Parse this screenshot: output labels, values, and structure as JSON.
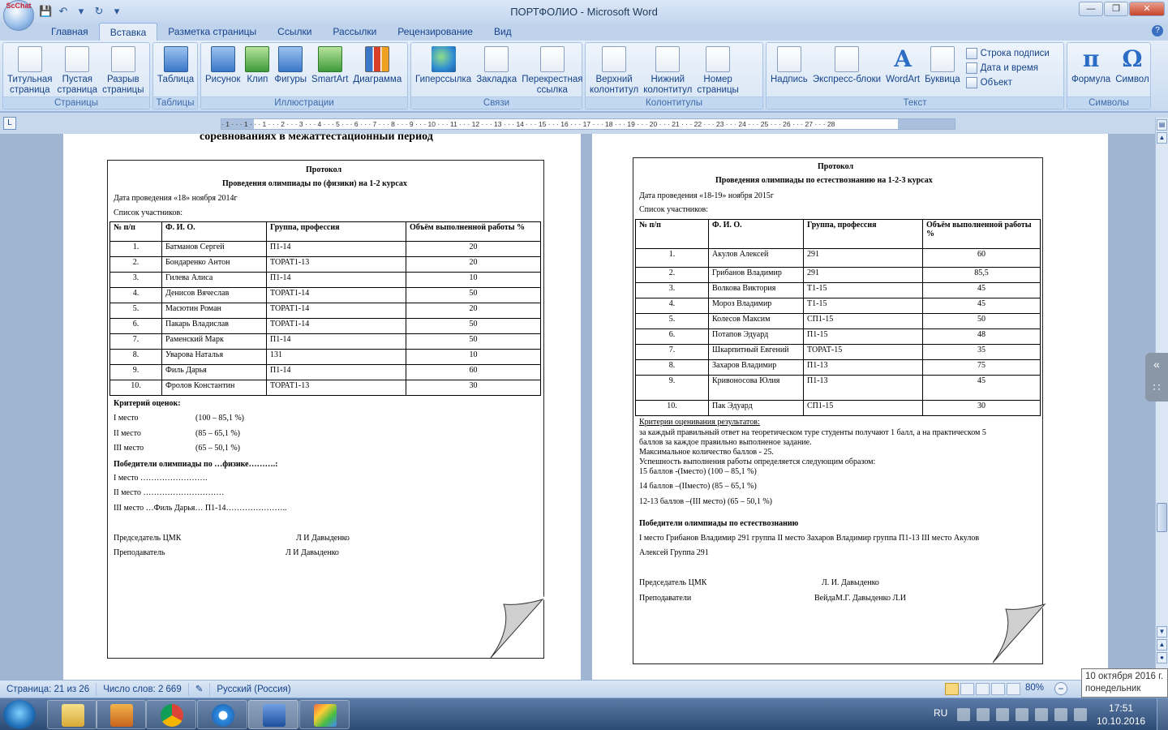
{
  "window": {
    "title": "ПОРТФОЛИО - Microsoft Word",
    "office_badge": "ScChat"
  },
  "tabs": [
    "Главная",
    "Вставка",
    "Разметка страницы",
    "Ссылки",
    "Рассылки",
    "Рецензирование",
    "Вид"
  ],
  "ribbon": {
    "pages": {
      "label": "Страницы",
      "buttons": [
        "Титульная\nстраница",
        "Пустая\nстраница",
        "Разрыв\nстраницы"
      ]
    },
    "tables": {
      "label": "Таблицы",
      "buttons": [
        "Таблица"
      ]
    },
    "illustrations": {
      "label": "Иллюстрации",
      "buttons": [
        "Рисунок",
        "Клип",
        "Фигуры",
        "SmartArt",
        "Диаграмма"
      ]
    },
    "links": {
      "label": "Связи",
      "buttons": [
        "Гиперссылка",
        "Закладка",
        "Перекрестная\nссылка"
      ]
    },
    "headers": {
      "label": "Колонтитулы",
      "buttons": [
        "Верхний\nколонтитул",
        "Нижний\nколонтитул",
        "Номер\nстраницы"
      ]
    },
    "text": {
      "label": "Текст",
      "buttons": [
        "Надпись",
        "Экспресс-блоки",
        "WordArt",
        "Буквица"
      ],
      "small": [
        "Строка подписи",
        "Дата и время",
        "Объект"
      ]
    },
    "symbols": {
      "label": "Символы",
      "buttons": [
        "Формула",
        "Символ"
      ]
    }
  },
  "ruler": {
    "marks": "· 1 · · · 1 · · · 1 · · · 2 · · · 3 · · · 4 · · · 5 · · · 6 · · · 7 · · · 8 · · · 9 · · · 10 · · · 11 · · · 12 · · · 13 · · · 14 · · · 15 · · · 16 · · · 17 · · · 18 · · · 19 · · · 20 · · · 21 · · · 22 · · · 23 · · · 24 · · · 25 · · · 26 · · · 27 · · · 28"
  },
  "left_page": {
    "heading": "соревнованиях в межаттестационный период",
    "title": "Протокол",
    "subtitle": "Проведения олимпиады по (физики) на 1-2 курсах",
    "date": "Дата проведения «18» ноября 2014г",
    "list_label": "Список участников:",
    "table_header": [
      "№ п/п",
      "Ф. И. О.",
      "Группа, профессия",
      "Объём выполненной работы %"
    ],
    "rows": [
      [
        "1.",
        "Батманов Сергей",
        "П1-14",
        "20"
      ],
      [
        "2.",
        "Бондаренко Антон",
        "ТОРАТ1-13",
        "20"
      ],
      [
        "3.",
        "Гилева Алиса",
        "П1-14",
        "10"
      ],
      [
        "4.",
        "Денисов Вячеслав",
        "ТОРАТ1-14",
        "50"
      ],
      [
        "5.",
        "Масютин Роман",
        "ТОРАТ1-14",
        "20"
      ],
      [
        "6.",
        "Пакарь Владислав",
        "ТОРАТ1-14",
        "50"
      ],
      [
        "7.",
        "Раменский Марк",
        "П1-14",
        "50"
      ],
      [
        "8.",
        "Уварова Наталья",
        "131",
        "10"
      ],
      [
        "9.",
        "Филь Дарья",
        "П1-14",
        "60"
      ],
      [
        "10.",
        "Фролов Константин",
        "ТОРАТ1-13",
        "30"
      ]
    ],
    "criteria_title": "Критерий оценок:",
    "criteria": [
      [
        "I место",
        "(100 – 85,1 %)"
      ],
      [
        "II место",
        "(85 – 65,1 %)"
      ],
      [
        "III место",
        "(65 – 50,1 %)"
      ]
    ],
    "winners_title": "Победители олимпиады по …физике……….:",
    "winners": [
      "I место …………………….",
      "II место …………………………",
      "III место …Филь Дарья… П1-14………………….."
    ],
    "chair_label": "Председатель ЦМК",
    "chair_name": "Л И Давыденко",
    "teacher_label": "Преподаватель",
    "teacher_name": "Л И Давыденко"
  },
  "right_page": {
    "title": "Протокол",
    "subtitle": "Проведения олимпиады по естествознанию на 1-2-3 курсах",
    "date": "Дата проведения «18-19» ноября 2015г",
    "list_label": "Список участников:",
    "table_header": [
      "№ п/п",
      "Ф. И. О.",
      "Группа, профессия",
      "Объём выполненной работы %"
    ],
    "rows": [
      [
        "1.",
        "Акулов Алексей",
        "291",
        "60"
      ],
      [
        "2.",
        "Грибанов Владимир",
        "291",
        "85,5"
      ],
      [
        "3.",
        "Волкова Виктория",
        "Т1-15",
        "45"
      ],
      [
        "4.",
        "Мороз Владимир",
        "Т1-15",
        "45"
      ],
      [
        "5.",
        "Колесов Максим",
        "СП1-15",
        "50"
      ],
      [
        "6.",
        "Потапов Эдуард",
        "П1-15",
        "48"
      ],
      [
        "7.",
        "Шкарпитный Евгений",
        "ТОРАТ-15",
        "35"
      ],
      [
        "8.",
        "Захаров Владимир",
        "П1-13",
        "75"
      ],
      [
        "9.",
        "Кривоносова Юлия",
        "П1-13",
        "45"
      ],
      [
        "10.",
        "Пак Эдуард",
        "СП1-15",
        "30"
      ]
    ],
    "criteria_title": "Критерии оценивания результатов:",
    "criteria_lines": [
      "за каждый правильный ответ на теоретическом туре  студенты получают 1 балл, а на практическом 5",
      "баллов за каждое правильно выполненое задание.",
      "Максимальное количество баллов - 25.",
      "Успешность выполнения работы определяется следующим образом:",
      " 15 баллов  -(Iместо) (100 – 85,1 %)",
      "14 баллов –(IIместо) (85 – 65,1 %)",
      " 12-13 баллов –(III место) (65 – 50,1 %)"
    ],
    "winners_title": "Победители олимпиады по естествознанию",
    "winners_line1": "I место Грибанов Владимир 291 группа II место  Захаров Владимир группа П1-13   III место Акулов",
    "winners_line2": "Алексей Группа 291",
    "chair_label": "Председатель ЦМК",
    "chair_name": "Л. И. Давыденко",
    "teacher_label": "Преподаватели",
    "teacher_name": "ВейдаМ.Г. Давыденко Л.И"
  },
  "statusbar": {
    "page": "Страница: 21 из 26",
    "words": "Число слов: 2 669",
    "language": "Русский (Россия)",
    "zoom": "80%"
  },
  "tooltip": {
    "date": "10 октября 2016 г.",
    "weekday": "понедельник"
  },
  "taskbar": {
    "lang": "RU",
    "time": "17:51",
    "date": "10.10.2016"
  }
}
